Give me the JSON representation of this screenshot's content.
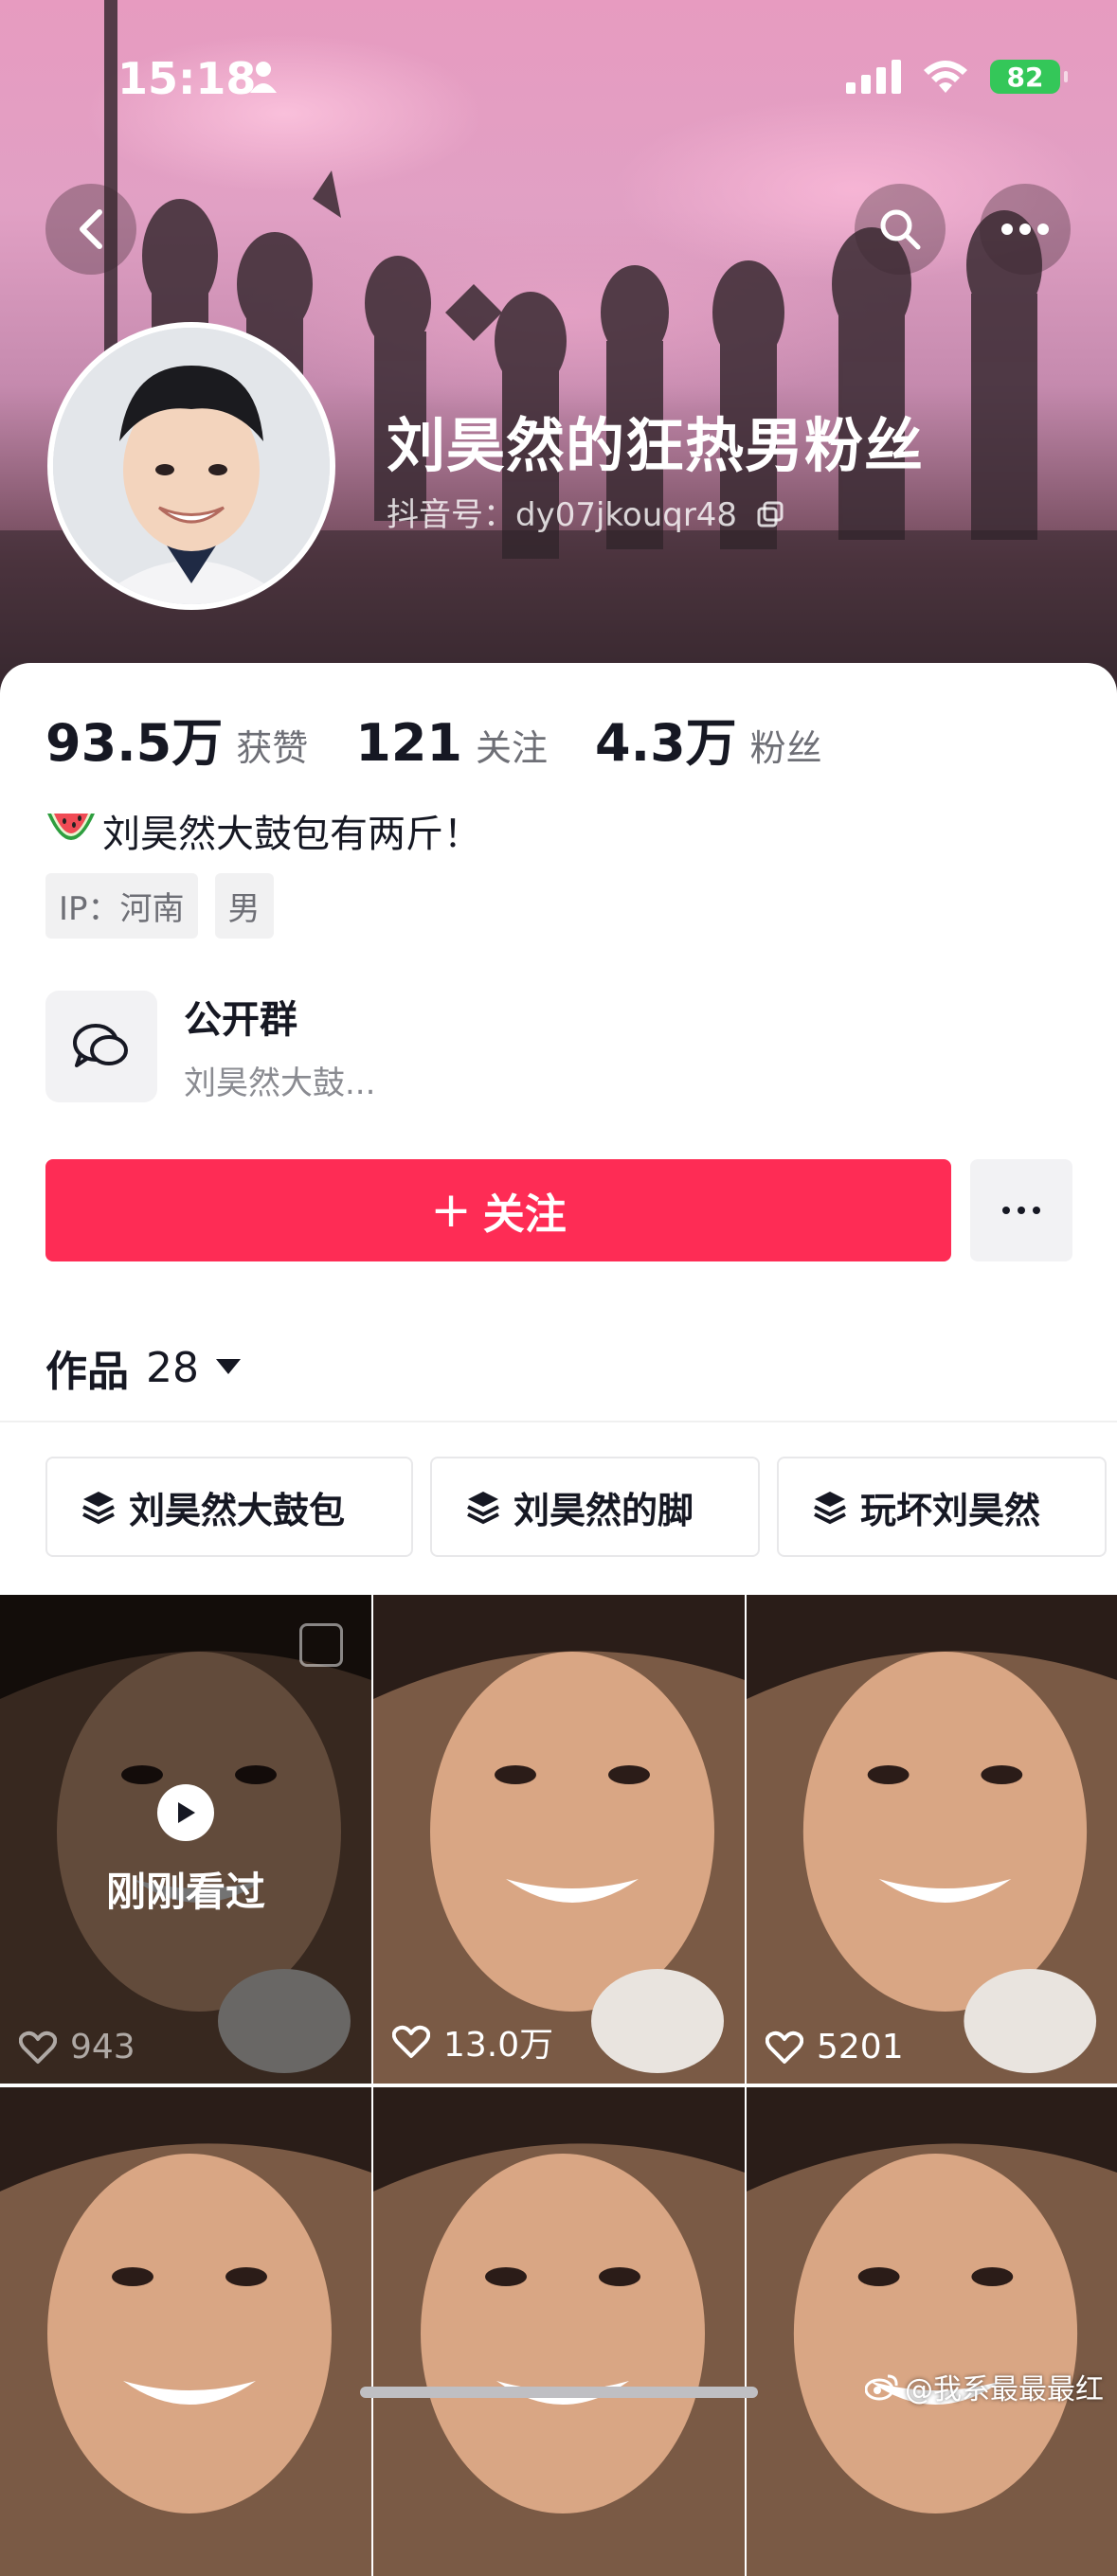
{
  "status_bar": {
    "time": "15:18",
    "battery": "82"
  },
  "profile": {
    "nickname": "刘昊然的狂热男粉丝",
    "douyin_id": "抖音号：dy07jkouqr48",
    "stats": [
      {
        "value": "93.5万",
        "label": "获赞"
      },
      {
        "value": "121",
        "label": "关注"
      },
      {
        "value": "4.3万",
        "label": "粉丝"
      }
    ],
    "bio": "刘昊然大鼓包有两斤！",
    "tags": [
      "IP：河南",
      "男"
    ]
  },
  "group": {
    "title": "公开群",
    "subtitle": "刘昊然大鼓..."
  },
  "actions": {
    "follow_label": "关注",
    "plus": "+"
  },
  "works": {
    "label": "作品",
    "count": "28"
  },
  "collections": [
    "刘昊然大鼓包",
    "刘昊然的脚",
    "玩坏刘昊然"
  ],
  "videos": [
    {
      "likes": "943",
      "watched": true,
      "watched_label": "刚刚看过"
    },
    {
      "likes": "13.0万"
    },
    {
      "likes": "5201"
    },
    {
      "likes": ""
    },
    {
      "likes": ""
    },
    {
      "likes": ""
    }
  ],
  "watermark": "@我系最最最红",
  "colors": {
    "accent": "#fe2c55",
    "battery": "#34c759"
  }
}
